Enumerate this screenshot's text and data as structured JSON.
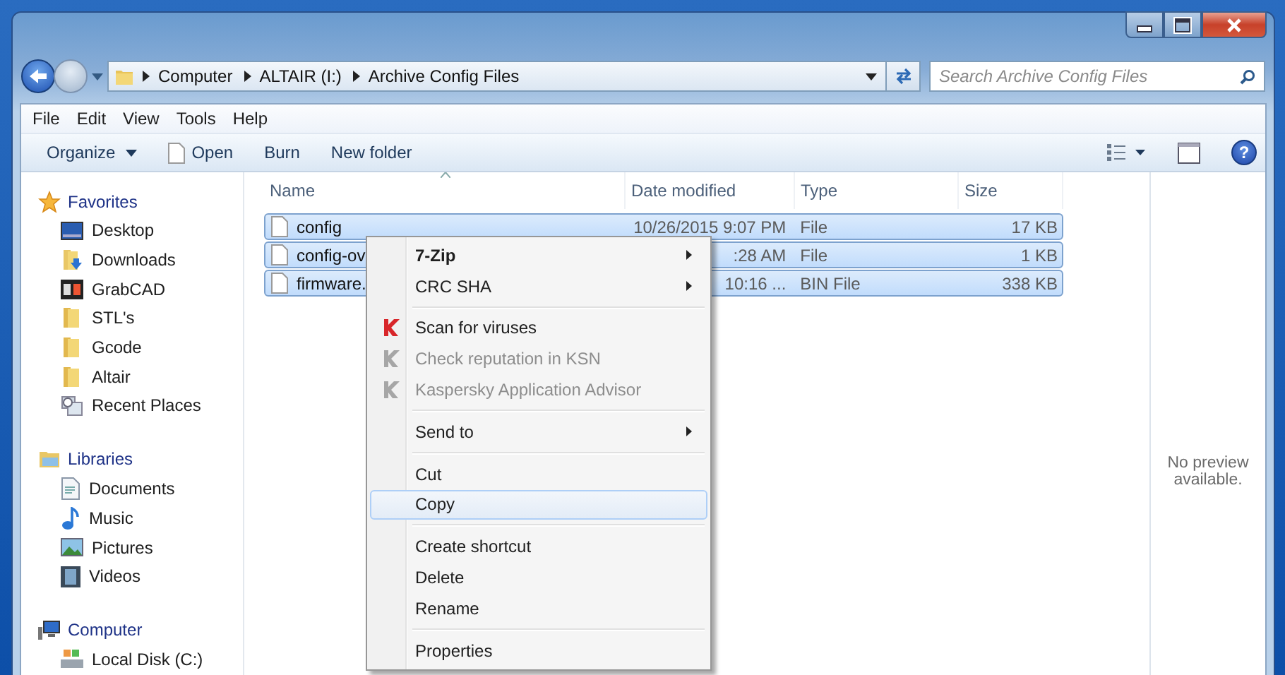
{
  "help_button": {
    "label": "?"
  },
  "address": {
    "breadcrumbs": [
      "Computer",
      "ALTAIR (I:)",
      "Archive Config Files"
    ]
  },
  "search": {
    "placeholder": "Search Archive Config Files"
  },
  "menu_bar": [
    "File",
    "Edit",
    "View",
    "Tools",
    "Help"
  ],
  "toolbar": [
    {
      "label": "Organize",
      "kind": "dropdown"
    },
    {
      "label": "Open",
      "kind": "open"
    },
    {
      "label": "Burn",
      "kind": "plain"
    },
    {
      "label": "New folder",
      "kind": "plain"
    }
  ],
  "sidebar": {
    "sections": [
      {
        "label": "Favorites",
        "kind": "star",
        "children": [
          {
            "label": "Desktop",
            "kind": "desktop"
          },
          {
            "label": "Downloads",
            "kind": "downloads"
          },
          {
            "label": "GrabCAD",
            "kind": "app"
          },
          {
            "label": "STL's",
            "kind": "folder"
          },
          {
            "label": "Gcode",
            "kind": "folder"
          },
          {
            "label": "Altair",
            "kind": "folder"
          },
          {
            "label": "Recent Places",
            "kind": "recent"
          }
        ]
      },
      {
        "label": "Libraries",
        "kind": "library",
        "children": [
          {
            "label": "Documents",
            "kind": "documents"
          },
          {
            "label": "Music",
            "kind": "music"
          },
          {
            "label": "Pictures",
            "kind": "pictures"
          },
          {
            "label": "Videos",
            "kind": "videos"
          }
        ]
      },
      {
        "label": "Computer",
        "kind": "computer",
        "children": [
          {
            "label": "Local Disk (C:)",
            "kind": "drive"
          }
        ]
      }
    ]
  },
  "table": {
    "columns": [
      "Name",
      "Date modified",
      "Type",
      "Size"
    ],
    "rows": [
      {
        "name": "config",
        "date": "10/26/2015 9:07 PM",
        "type": "File",
        "size": "17 KB",
        "selected": true
      },
      {
        "name": "config-ov",
        "date": ":28 AM",
        "type": "File",
        "size": "1 KB",
        "selected": true
      },
      {
        "name": "firmware.",
        "date": "10:16 ...",
        "type": "BIN File",
        "size": "338 KB",
        "selected": true
      }
    ]
  },
  "context_menu": [
    {
      "kind": "item",
      "label": "7-Zip",
      "bold": true,
      "submenu": true,
      "disabled": false,
      "selected": false
    },
    {
      "kind": "item",
      "label": "CRC SHA",
      "bold": false,
      "submenu": true,
      "disabled": false,
      "selected": false
    },
    {
      "kind": "separator"
    },
    {
      "kind": "av-item",
      "label": "Scan for viruses",
      "bold": false,
      "submenu": false,
      "disabled": false,
      "selected": false
    },
    {
      "kind": "av-item",
      "label": "Check reputation in KSN",
      "bold": false,
      "submenu": false,
      "disabled": true,
      "selected": false
    },
    {
      "kind": "av-item",
      "label": "Kaspersky Application Advisor",
      "bold": false,
      "submenu": false,
      "disabled": true,
      "selected": false
    },
    {
      "kind": "separator"
    },
    {
      "kind": "item",
      "label": "Send to",
      "bold": false,
      "submenu": true,
      "disabled": false,
      "selected": false
    },
    {
      "kind": "separator"
    },
    {
      "kind": "item",
      "label": "Cut",
      "bold": false,
      "submenu": false,
      "disabled": false,
      "selected": false
    },
    {
      "kind": "item",
      "label": "Copy",
      "bold": false,
      "submenu": false,
      "disabled": false,
      "selected": true
    },
    {
      "kind": "separator"
    },
    {
      "kind": "item",
      "label": "Create shortcut",
      "bold": false,
      "submenu": false,
      "disabled": false,
      "selected": false
    },
    {
      "kind": "item",
      "label": "Delete",
      "bold": false,
      "submenu": false,
      "disabled": false,
      "selected": false
    },
    {
      "kind": "item",
      "label": "Rename",
      "bold": false,
      "submenu": false,
      "disabled": false,
      "selected": false
    },
    {
      "kind": "separator"
    },
    {
      "kind": "item",
      "label": "Properties",
      "bold": false,
      "submenu": false,
      "disabled": false,
      "selected": false
    }
  ],
  "preview": {
    "text": "No preview available."
  }
}
